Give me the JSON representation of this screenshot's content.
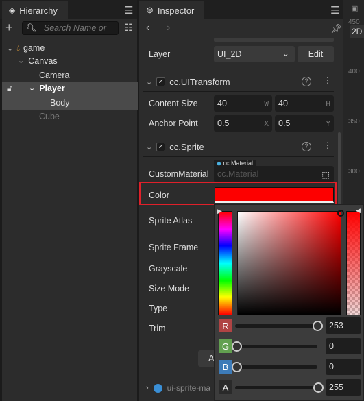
{
  "hierarchy": {
    "tab": "Hierarchy",
    "search_placeholder": "Search Name or",
    "tree": [
      {
        "label": "game"
      },
      {
        "label": "Canvas"
      },
      {
        "label": "Camera"
      },
      {
        "label": "Player"
      },
      {
        "label": "Body"
      },
      {
        "label": "Cube"
      }
    ]
  },
  "inspector": {
    "tab": "Inspector",
    "layer": {
      "label": "Layer",
      "value": "UI_2D",
      "edit": "Edit"
    },
    "uitransform": {
      "title": "cc.UITransform",
      "content_size_label": "Content Size",
      "w": "40",
      "w_suffix": "W",
      "h": "40",
      "h_suffix": "H",
      "anchor_label": "Anchor Point",
      "ax": "0.5",
      "ax_suffix": "X",
      "ay": "0.5",
      "ay_suffix": "Y"
    },
    "sprite": {
      "title": "cc.Sprite",
      "custom_material_label": "CustomMaterial",
      "material_tag": "cc.Material",
      "material_placeholder": "cc.Material",
      "color_label": "Color",
      "color_value": "#fd0000",
      "sprite_atlas": "Sprite Atlas",
      "sprite_frame": "Sprite Frame",
      "grayscale": "Grayscale",
      "size_mode": "Size Mode",
      "type": "Type",
      "trim": "Trim",
      "button_partial": "A"
    },
    "next_component": "ui-sprite-ma"
  },
  "color_picker": {
    "r_label": "R",
    "r": "253",
    "g_label": "G",
    "g": "0",
    "b_label": "B",
    "b": "0",
    "a_label": "A",
    "a": "255",
    "hue_color": "#ff0000",
    "highlight_color": "#e0202a"
  },
  "scene": {
    "mode": "2D",
    "ruler": [
      "450",
      "400",
      "350",
      "300"
    ]
  }
}
